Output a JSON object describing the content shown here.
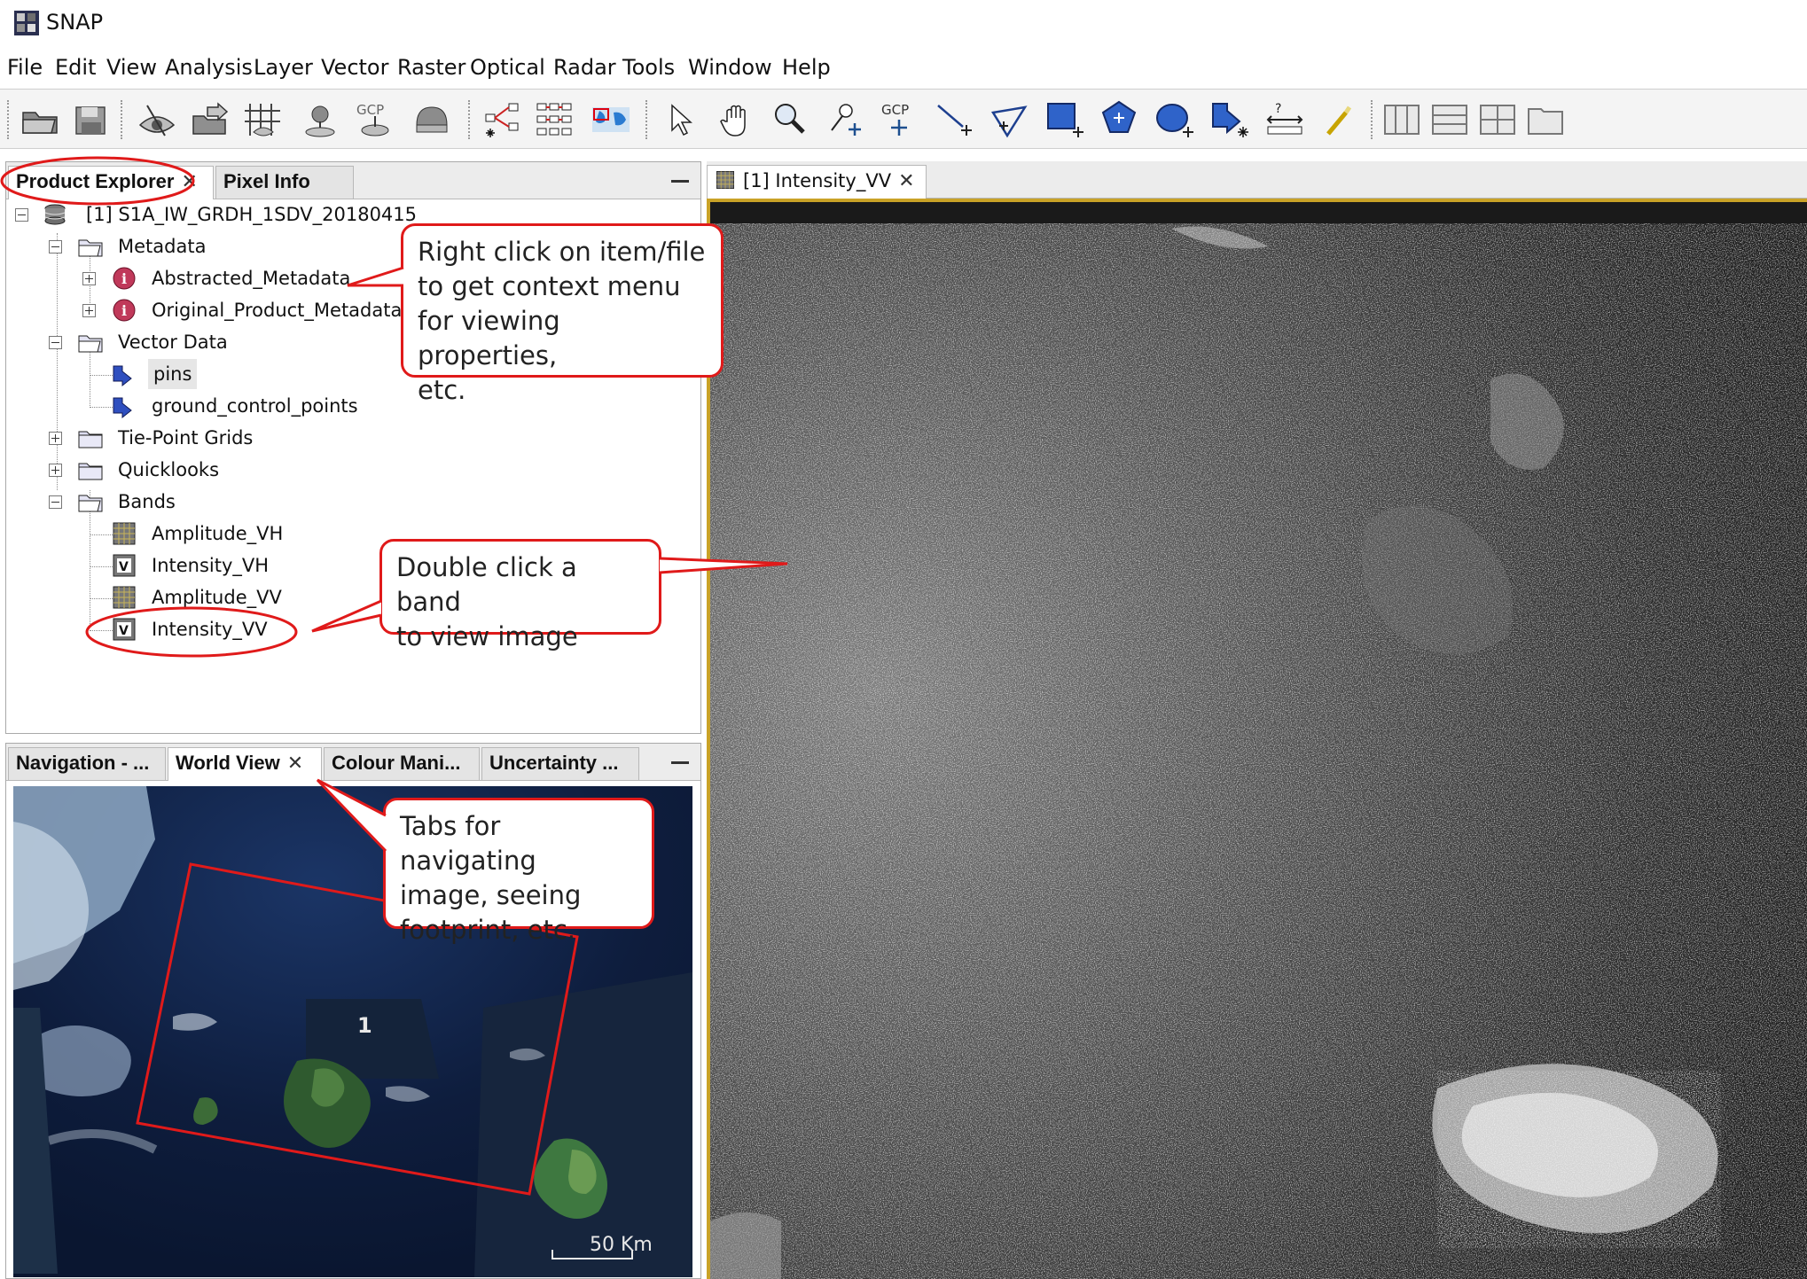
{
  "app": {
    "title": "SNAP",
    "icon": "snap-app-icon"
  },
  "menu": [
    "File",
    "Edit",
    "View",
    "Analysis",
    "Layer",
    "Vector",
    "Raster",
    "Optical",
    "Radar",
    "Tools",
    "Window",
    "Help"
  ],
  "toolbar": {
    "gcp_label": "GCP",
    "icons": [
      "open-product-icon",
      "save-product-icon",
      "layer-visibility-icon",
      "export-icon",
      "graticule-icon",
      "pin-manager-icon",
      "gcp-manager-icon",
      "mask-manager-icon",
      "graph-builder-icon",
      "batch-processing-icon",
      "world-map-icon",
      "select-tool-icon",
      "pan-tool-icon",
      "zoom-tool-icon",
      "pin-placing-icon",
      "gcp-placing-icon",
      "line-drawing-icon",
      "polyline-drawing-icon",
      "rectangle-drawing-icon",
      "polygon-drawing-icon",
      "ellipse-drawing-icon",
      "insert-figure-icon",
      "range-finder-icon",
      "magic-wand-icon",
      "tile-horizontal-icon",
      "tile-vertical-icon",
      "tile-grid-icon",
      "tile-single-icon"
    ]
  },
  "top_panel": {
    "tabs": [
      {
        "label": "Product Explorer",
        "close": "✕"
      },
      {
        "label": "Pixel Info"
      }
    ],
    "tree": [
      {
        "label": "[1] S1A_IW_GRDH_1SDV_20180415",
        "icon": "product-icon",
        "expander": "minus"
      },
      {
        "label": "Metadata",
        "icon": "folder-open-icon",
        "expander": "minus"
      },
      {
        "label": "Abstracted_Metadata",
        "icon": "metadata-info-icon",
        "expander": "plus"
      },
      {
        "label": "Original_Product_Metadata",
        "icon": "metadata-info-icon",
        "expander": "plus"
      },
      {
        "label": "Vector Data",
        "icon": "folder-open-icon",
        "expander": "minus"
      },
      {
        "label": "pins",
        "icon": "vector-data-icon"
      },
      {
        "label": "ground_control_points",
        "icon": "vector-data-icon"
      },
      {
        "label": "Tie-Point Grids",
        "icon": "folder-closed-icon",
        "expander": "plus"
      },
      {
        "label": "Quicklooks",
        "icon": "folder-closed-icon",
        "expander": "plus"
      },
      {
        "label": "Bands",
        "icon": "folder-open-icon",
        "expander": "minus"
      },
      {
        "label": "Amplitude_VH",
        "icon": "band-icon"
      },
      {
        "label": "Intensity_VH",
        "icon": "virtual-band-icon"
      },
      {
        "label": "Amplitude_VV",
        "icon": "band-icon"
      },
      {
        "label": "Intensity_VV",
        "icon": "virtual-band-icon"
      }
    ]
  },
  "bottom_panel": {
    "tabs": [
      {
        "label": "Navigation - ..."
      },
      {
        "label": "World View",
        "close": "✕"
      },
      {
        "label": "Colour Mani..."
      },
      {
        "label": "Uncertainty ..."
      }
    ],
    "footprint_label": "1",
    "scale_label": "50 Km"
  },
  "image_window": {
    "tab_label": "[1] Intensity_VV",
    "close": "✕"
  },
  "callouts": {
    "context_menu": [
      "Right click on item/file",
      "to get context menu",
      "for viewing properties,",
      "etc."
    ],
    "double_click": [
      "Double click a band",
      "to view image"
    ],
    "tabs": [
      "Tabs for navigating",
      "image, seeing",
      "footprint, etc."
    ]
  },
  "colors": {
    "annotation": "#e01a1a",
    "view_border": "#c9a227",
    "selected_row": "#e6e6e6"
  }
}
